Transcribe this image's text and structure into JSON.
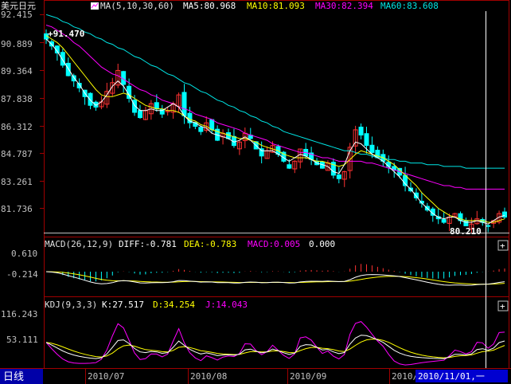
{
  "price_header": {
    "instrument": "美元日元",
    "ma_params": "MA(5,10,30,60)",
    "ma5": "MA5:80.968",
    "ma10": "MA10:81.093",
    "ma30": "MA30:82.394",
    "ma60": "MA60:83.608"
  },
  "macd_header": {
    "params": "MACD(26,12,9)",
    "diff": "DIFF:-0.781",
    "dea": "DEA:-0.783",
    "macd": "MACD:0.005",
    "extra": "0.000"
  },
  "kdj_header": {
    "params": "KDJ(9,3,3)",
    "k": "K:27.517",
    "d": "D:34.254",
    "j": "J:14.043"
  },
  "annotations": {
    "high_label": "+91.470",
    "low_label": "80.210"
  },
  "bottom_bar": {
    "period_tab": "日线",
    "cursor_date": "2010/11/01,一",
    "months": [
      "2010/07",
      "2010/08",
      "2010/09",
      "2010/10"
    ]
  },
  "panel_buttons": {
    "macd_toggle": "+",
    "kdj_toggle": "+"
  },
  "colors": {
    "up": "#ff3232",
    "down": "#00ffff",
    "ma5": "#ffffff",
    "ma10": "#ffff00",
    "ma30": "#ff00ff",
    "ma60": "#00e5e5",
    "axis": "#a00000",
    "text": "#c0c0c0"
  },
  "chart_data": [
    {
      "type": "candlestick",
      "title": "美元日元",
      "ylim": [
        80.2,
        92.415
      ],
      "y_ticks": [
        "92.415",
        "90.889",
        "89.364",
        "87.838",
        "86.312",
        "84.787",
        "83.261",
        "81.736"
      ],
      "high": 91.47,
      "low": 80.21,
      "close_series": [
        91.0,
        90.6,
        90.2,
        89.5,
        88.9,
        88.6,
        88.2,
        87.7,
        87.2,
        87.1,
        87.4,
        88.0,
        88.5,
        89.2,
        88.4,
        87.6,
        86.8,
        86.5,
        86.9,
        87.3,
        87.0,
        86.7,
        86.9,
        87.3,
        87.8,
        86.6,
        86.2,
        86.0,
        85.7,
        86.2,
        85.8,
        85.2,
        85.6,
        85.3,
        84.9,
        85.1,
        85.6,
        85.3,
        84.7,
        84.3,
        84.6,
        84.9,
        84.4,
        84.0,
        83.6,
        84.0,
        84.7,
        84.3,
        84.1,
        83.8,
        83.6,
        83.9,
        83.2,
        83.0,
        83.4,
        84.8,
        85.8,
        85.5,
        84.9,
        84.5,
        84.2,
        84.0,
        83.7,
        83.5,
        83.2,
        82.6,
        82.3,
        81.9,
        81.6,
        81.2,
        80.9,
        80.7,
        80.5,
        80.8,
        81.0,
        80.6,
        80.3,
        80.4,
        80.7,
        80.5,
        80.3,
        80.6,
        81.0,
        80.8
      ],
      "ma_lines": {
        "MA5": [
          91.0,
          90.7,
          90.3,
          89.8,
          89.3,
          88.8,
          88.4,
          87.9,
          87.5,
          87.2,
          87.4,
          87.8,
          88.3,
          88.6,
          88.3,
          87.8,
          87.2,
          86.9,
          86.9,
          87.0,
          86.9,
          86.9,
          87.1,
          87.3,
          87.1,
          86.6,
          86.3,
          86.2,
          86.0,
          85.9,
          85.6,
          85.5,
          85.4,
          85.3,
          85.1,
          85.2,
          85.4,
          85.2,
          84.9,
          84.6,
          84.6,
          84.6,
          84.4,
          84.2,
          84.0,
          84.2,
          84.4,
          84.3,
          84.1,
          83.9,
          83.8,
          83.7,
          83.4,
          83.3,
          83.8,
          84.6,
          85.1,
          85.0,
          84.7,
          84.4,
          84.2,
          84.0,
          83.7,
          83.4,
          83.1,
          82.7,
          82.4,
          82.0,
          81.6,
          81.3,
          81.0,
          80.8,
          80.7,
          80.8,
          80.8,
          80.6,
          80.5,
          80.5,
          80.6,
          80.5,
          80.4,
          80.6,
          80.8,
          80.9
        ],
        "MA10": [
          91.2,
          91.0,
          90.8,
          90.5,
          90.1,
          89.7,
          89.3,
          88.9,
          88.5,
          88.1,
          87.8,
          87.7,
          87.7,
          87.8,
          87.9,
          87.8,
          87.6,
          87.4,
          87.2,
          87.1,
          87.0,
          87.0,
          86.9,
          86.9,
          86.8,
          86.6,
          86.4,
          86.3,
          86.1,
          86.0,
          85.8,
          85.7,
          85.6,
          85.5,
          85.4,
          85.3,
          85.3,
          85.2,
          85.1,
          84.9,
          84.8,
          84.7,
          84.6,
          84.4,
          84.3,
          84.2,
          84.2,
          84.2,
          84.1,
          84.0,
          84.0,
          83.9,
          83.8,
          83.7,
          83.8,
          84.1,
          84.4,
          84.6,
          84.5,
          84.4,
          84.3,
          84.2,
          84.0,
          83.8,
          83.5,
          83.2,
          82.9,
          82.6,
          82.2,
          81.9,
          81.6,
          81.3,
          81.1,
          80.9,
          80.8,
          80.7,
          80.6,
          80.6,
          80.6,
          80.6,
          80.5,
          80.5,
          80.6,
          80.7
        ],
        "MA30": [
          91.8,
          91.7,
          91.5,
          91.3,
          91.1,
          90.8,
          90.6,
          90.3,
          90.0,
          89.7,
          89.4,
          89.2,
          89.0,
          88.9,
          88.7,
          88.5,
          88.3,
          88.1,
          88.0,
          87.8,
          87.7,
          87.5,
          87.4,
          87.3,
          87.1,
          87.0,
          86.9,
          86.7,
          86.6,
          86.5,
          86.4,
          86.2,
          86.1,
          86.0,
          85.9,
          85.8,
          85.6,
          85.5,
          85.4,
          85.3,
          85.2,
          85.0,
          84.9,
          84.8,
          84.7,
          84.6,
          84.5,
          84.5,
          84.4,
          84.3,
          84.2,
          84.2,
          84.1,
          84.0,
          84.0,
          84.0,
          84.0,
          84.0,
          83.9,
          83.9,
          83.8,
          83.7,
          83.6,
          83.5,
          83.4,
          83.3,
          83.2,
          83.1,
          83.0,
          82.9,
          82.8,
          82.7,
          82.6,
          82.6,
          82.5,
          82.5,
          82.4,
          82.4,
          82.4,
          82.4,
          82.4,
          82.4,
          82.4,
          82.4
        ],
        "MA60": [
          92.4,
          92.3,
          92.2,
          92.0,
          91.9,
          91.7,
          91.6,
          91.4,
          91.3,
          91.1,
          91.0,
          90.8,
          90.7,
          90.5,
          90.4,
          90.2,
          90.0,
          89.9,
          89.7,
          89.5,
          89.4,
          89.2,
          89.0,
          88.9,
          88.7,
          88.5,
          88.4,
          88.2,
          88.0,
          87.9,
          87.7,
          87.5,
          87.4,
          87.2,
          87.1,
          86.9,
          86.8,
          86.6,
          86.5,
          86.3,
          86.2,
          86.0,
          85.9,
          85.7,
          85.6,
          85.5,
          85.4,
          85.3,
          85.2,
          85.1,
          85.0,
          84.9,
          84.8,
          84.7,
          84.6,
          84.6,
          84.5,
          84.4,
          84.4,
          84.3,
          84.2,
          84.2,
          84.1,
          84.1,
          84.0,
          84.0,
          83.9,
          83.9,
          83.9,
          83.8,
          83.8,
          83.8,
          83.7,
          83.7,
          83.7,
          83.7,
          83.6,
          83.6,
          83.6,
          83.6,
          83.6,
          83.6,
          83.6,
          83.6
        ]
      }
    },
    {
      "type": "bar",
      "title": "MACD(26,12,9)",
      "y_ticks": [
        "0.610",
        "-0.214"
      ],
      "ylim": [
        -0.9,
        0.9
      ]
    },
    {
      "type": "line",
      "title": "KDJ(9,3,3)",
      "y_ticks": [
        "116.243",
        "53.111"
      ],
      "ylim": [
        -10,
        125
      ]
    }
  ]
}
